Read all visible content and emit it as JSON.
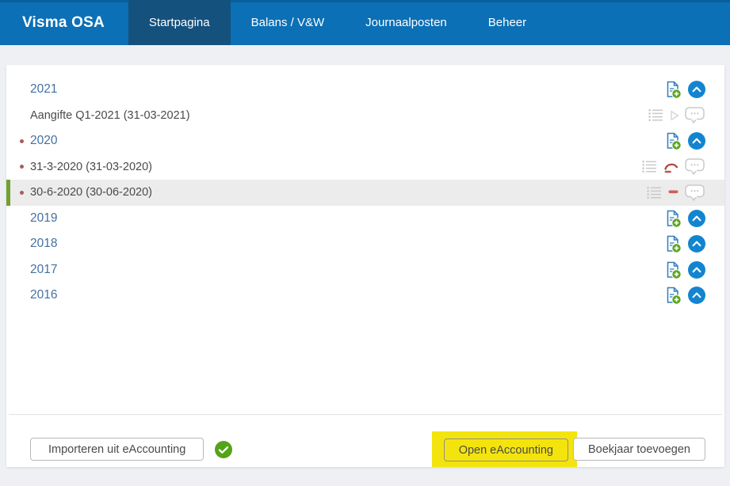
{
  "header": {
    "logo": "Visma OSA",
    "tabs": [
      {
        "label": "Startpagina",
        "active": true
      },
      {
        "label": "Balans / V&W",
        "active": false
      },
      {
        "label": "Journaalposten",
        "active": false
      },
      {
        "label": "Beheer",
        "active": false
      }
    ]
  },
  "rows": [
    {
      "type": "year",
      "label": "2021",
      "bullet": false
    },
    {
      "type": "entry",
      "label": "Aangifte Q1-2021 (31-03-2021)",
      "bullet": false,
      "status_icon": "play-icon"
    },
    {
      "type": "year",
      "label": "2020",
      "bullet": true
    },
    {
      "type": "entry",
      "label": "31-3-2020 (31-03-2020)",
      "bullet": true,
      "status_icon": "red-arc-icon"
    },
    {
      "type": "entry",
      "label": "30-6-2020 (30-06-2020)",
      "bullet": true,
      "status_icon": "red-minus-icon",
      "selected": true
    },
    {
      "type": "year",
      "label": "2019",
      "bullet": false
    },
    {
      "type": "year",
      "label": "2018",
      "bullet": false
    },
    {
      "type": "year",
      "label": "2017",
      "bullet": false
    },
    {
      "type": "year",
      "label": "2016",
      "bullet": false
    }
  ],
  "footer": {
    "import_button": "Importeren uit eAccounting",
    "open_button": "Open eAccounting",
    "add_button": "Boekjaar toevoegen"
  },
  "colors": {
    "header_blue": "#0b70b6",
    "active_tab_blue": "#15517d",
    "highlight_yellow": "#f4e40d",
    "selected_row_green": "#71a230",
    "success_green": "#54a318",
    "alert_red": "#bf4a42",
    "year_link_blue": "#44719e",
    "bullet_maroon": "#a85d5d"
  }
}
